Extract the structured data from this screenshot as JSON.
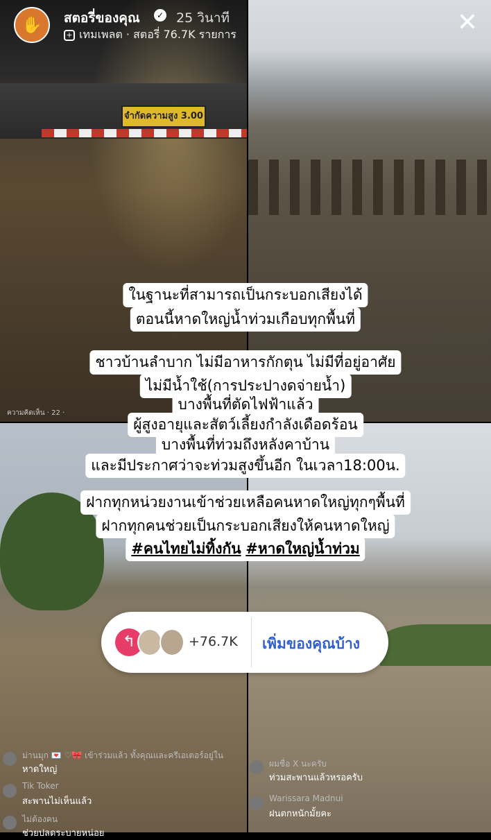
{
  "header": {
    "name": "สตอรี่ของคุณ",
    "time": "25 วินาที",
    "subtitle": "เทมเพลต · สตอรี่ 76.7K รายการ"
  },
  "photo_text": {
    "sign": "จำกัดความสูง 3.00 ม.",
    "caption": "ความคิดเห็น · 22 ·"
  },
  "story_text": {
    "lines": [
      "ในฐานะที่สามารถเป็นกระบอกเสียงได้",
      "ตอนนี้หาดใหญ่น้ำท่วมเกือบทุกพื้นที่",
      "ชาวบ้านลำบาก ไม่มีอาหารกักตุน ไม่มีที่อยู่อาศัย",
      "ไม่มีน้ำใช้(การประปางดจ่ายน้ำ)",
      "บางพื้นที่ตัดไฟฟ้าแล้ว",
      "ผู้สูงอายุและสัตว์เลี้ยงกำลังเดือดร้อน",
      "บางพื้นที่ท่วมถึงหลังคาบ้าน",
      "และมีประกาศว่าจะท่วมสูงขึ้นอีก ในเวลา18:00น.",
      "ฝากทุกหน่วยงานเข้าช่วยเหลือคนหาดใหญ่ทุกๆพื้นที่",
      "ฝากทุกคนช่วยเป็นกระบอกเสียงให้คนหาดใหญ่"
    ],
    "hashtag1": "#คนไทยไม่ทิ้งกัน",
    "hashtag2": "#หาดใหญ่น้ำท่วม"
  },
  "reply": {
    "count": "+76.7K",
    "add_label": "เพิ่มของคุณบ้าง"
  },
  "comments_left": [
    {
      "name": "ม่านมุก 💌 ♡🎀 เข้าร่วมแล้ว ทั้งคุณและครีเอเตอร์อยู่ใน",
      "text": "หาดใหญ่"
    },
    {
      "name": "Tik Toker",
      "text": "สะพานไม่เห็นแล้ว"
    },
    {
      "name": "ไม่ต้องคน",
      "text": "ช่วยปลดระบายหน่อย"
    }
  ],
  "comments_right": [
    {
      "name": "ผมชื่อ X นะครับ",
      "text": "ท่วมสะพานแล้วหรอครับ"
    },
    {
      "name": "Warissara Madnui",
      "text": "ฝนตกหนักมั้ยคะ"
    }
  ],
  "icons": {
    "close": "close-icon",
    "reply": "reply-arrow-icon",
    "template": "template-icon",
    "verified": "verified-badge-icon"
  },
  "colors": {
    "reply_button": "#e83c68",
    "add_label": "#2f5fd0"
  }
}
